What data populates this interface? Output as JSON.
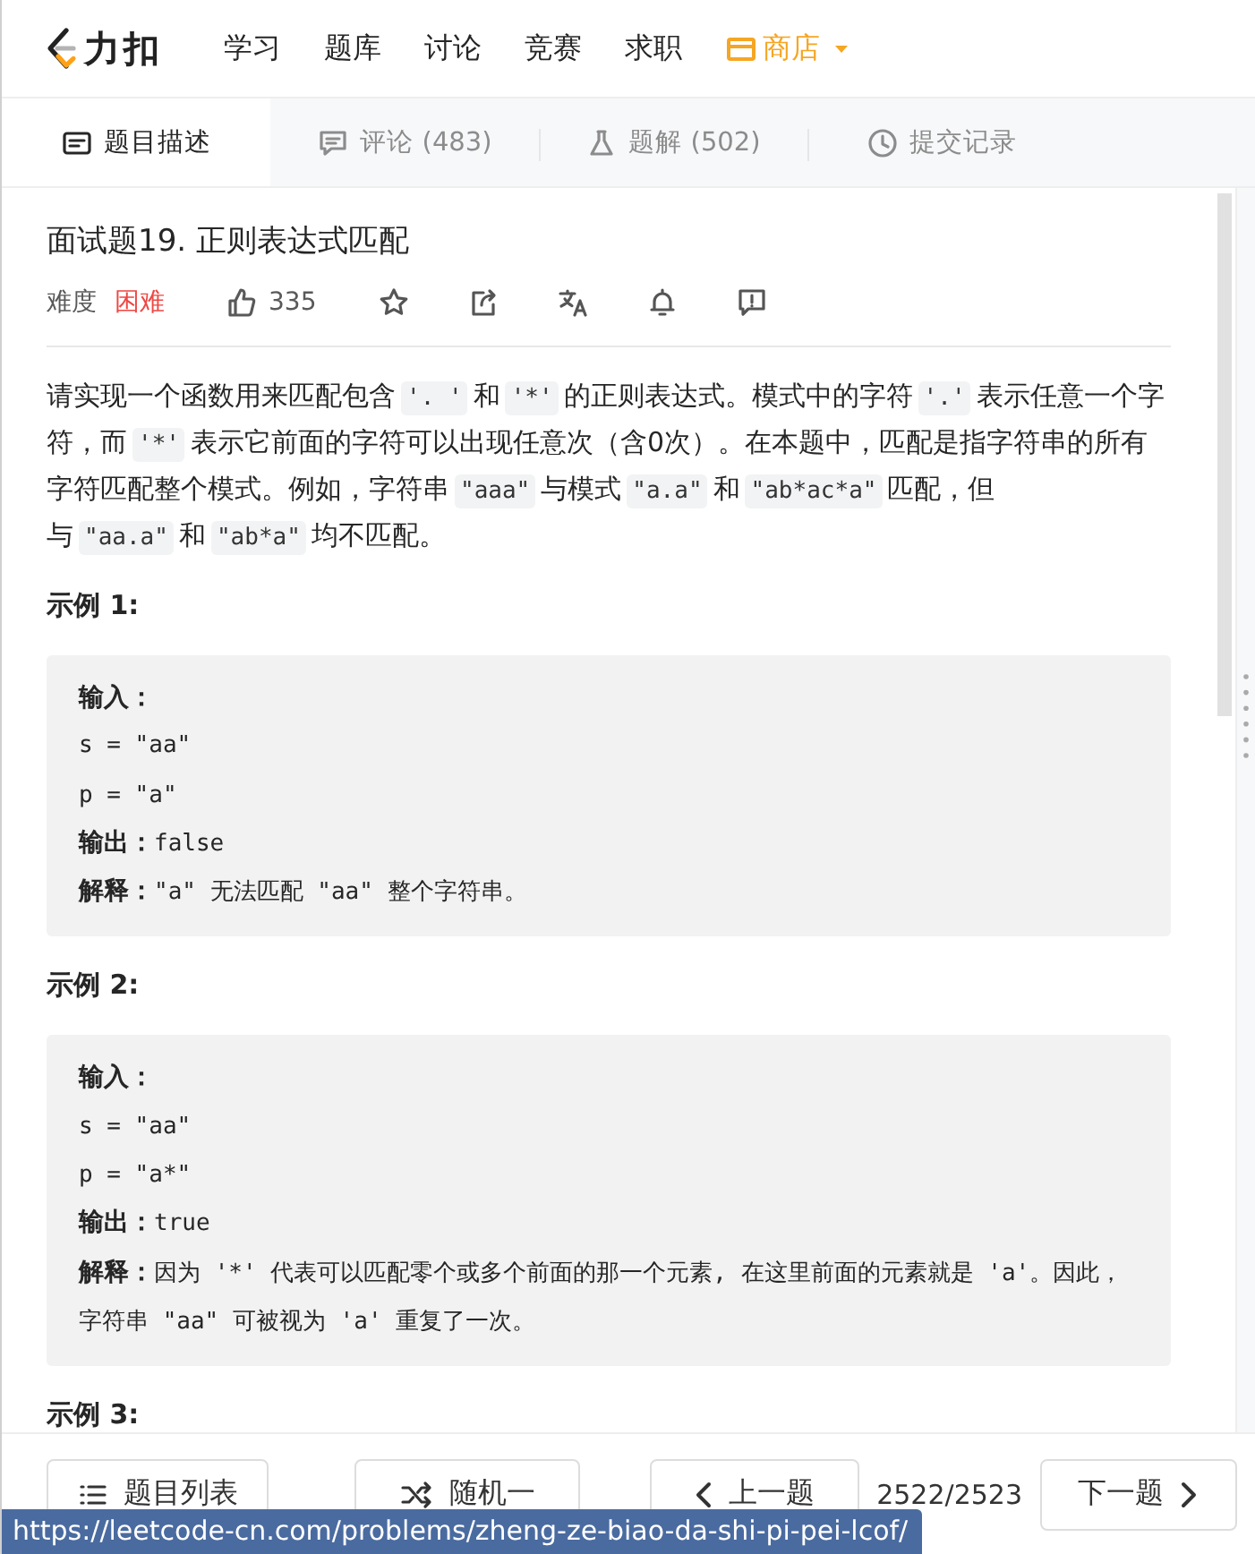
{
  "nav": {
    "logo": "力扣",
    "items": [
      {
        "kind": "link",
        "label": "学习"
      },
      {
        "kind": "link",
        "label": "题库"
      },
      {
        "kind": "link",
        "label": "讨论"
      },
      {
        "kind": "link",
        "label": "竞赛"
      },
      {
        "kind": "link",
        "label": "求职"
      },
      {
        "kind": "menu",
        "label": "商店"
      }
    ]
  },
  "tabs": [
    {
      "label": "题目描述",
      "selected": true
    },
    {
      "label": "评论 (483)",
      "selected": false
    },
    {
      "label": "题解 (502)",
      "selected": false
    },
    {
      "label": "提交记录",
      "selected": false
    }
  ],
  "problem": {
    "title": "面试题19. 正则表达式匹配",
    "difficulty_label": "难度",
    "difficulty": "困难",
    "likes": "335",
    "description": [
      {
        "kind": "text",
        "text": "请实现一个函数用来匹配包含"
      },
      {
        "kind": "code",
        "text": "'. '"
      },
      {
        "kind": "text",
        "text": "和"
      },
      {
        "kind": "code",
        "text": "'*'"
      },
      {
        "kind": "text",
        "text": "的正则表达式。模式中的字符"
      },
      {
        "kind": "code",
        "text": "'.'"
      },
      {
        "kind": "text",
        "text": "表示任意一个字符，而"
      },
      {
        "kind": "code",
        "text": "'*'"
      },
      {
        "kind": "text",
        "text": "表示它前面的字符可以出现任意次（含0次）。在本题中，匹配是指字符串的所有字符匹配整个模式。例如，字符串"
      },
      {
        "kind": "code",
        "text": "\"aaa\""
      },
      {
        "kind": "text",
        "text": "与模式"
      },
      {
        "kind": "code",
        "text": "\"a.a\""
      },
      {
        "kind": "text",
        "text": "和"
      },
      {
        "kind": "code",
        "text": "\"ab*ac*a\""
      },
      {
        "kind": "text",
        "text": "匹配，但与"
      },
      {
        "kind": "code",
        "text": "\"aa.a\""
      },
      {
        "kind": "text",
        "text": "和"
      },
      {
        "kind": "code",
        "text": "\"ab*a\""
      },
      {
        "kind": "text",
        "text": "均不匹配。"
      }
    ],
    "examples": [
      {
        "title": "示例 1:",
        "lines": [
          {
            "label": "输入："
          },
          {
            "value": "s = \"aa\""
          },
          {
            "value": "p = \"a\""
          },
          {
            "label": "输出：",
            "value": "false"
          },
          {
            "label": "解释：",
            "value": "\"a\" 无法匹配 \"aa\" 整个字符串。"
          }
        ]
      },
      {
        "title": "示例 2:",
        "lines": [
          {
            "label": "输入："
          },
          {
            "value": "s = \"aa\""
          },
          {
            "value": "p = \"a*\""
          },
          {
            "label": "输出：",
            "value": "true"
          },
          {
            "label": "解释：",
            "value": "因为 '*' 代表可以匹配零个或多个前面的那一个元素, 在这里前面的元素就是 'a'。因此，字符串 \"aa\" 可被视为 'a' 重复了一次。"
          }
        ]
      },
      {
        "title": "示例 3:"
      }
    ]
  },
  "footer": {
    "buttons": [
      {
        "kind": "list",
        "label": "题目列表"
      },
      {
        "kind": "random",
        "label": "随机一"
      },
      {
        "kind": "prev",
        "label": "上一题"
      },
      {
        "kind": "next",
        "label": "下一题"
      }
    ],
    "counter": "2522/2523"
  },
  "status_url": "https://leetcode-cn.com/problems/zheng-ze-biao-da-shi-pi-pei-lcof/"
}
